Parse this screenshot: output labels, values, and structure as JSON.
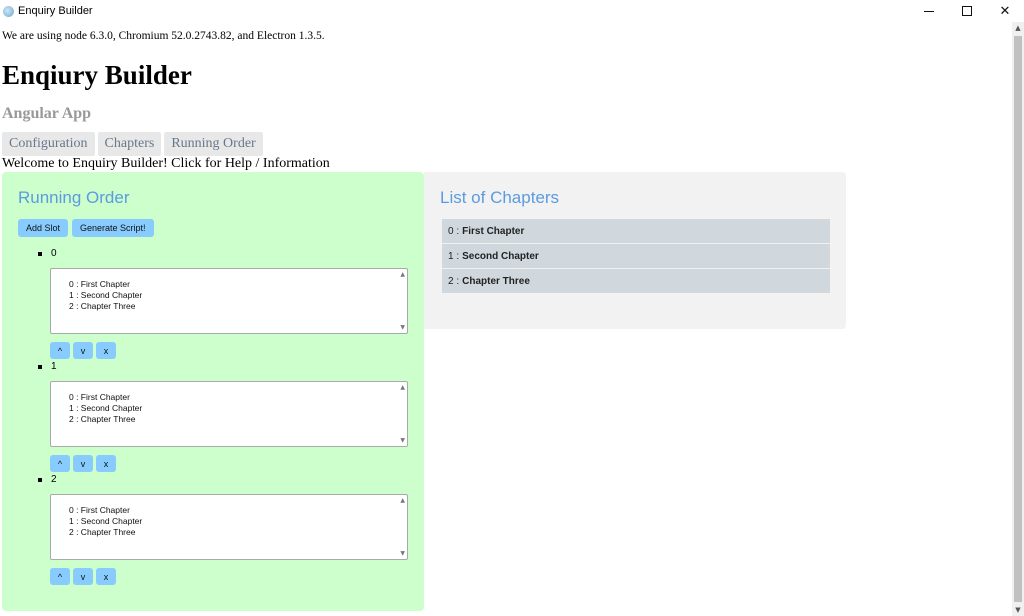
{
  "window": {
    "title": "Enquiry Builder",
    "controls": {
      "minimize": "",
      "maximize": "",
      "close": "✕"
    }
  },
  "page": {
    "version_text": "We are using node 6.3.0, Chromium 52.0.2743.82, and Electron 1.3.5.",
    "heading": "Enqiury Builder",
    "subheading": "Angular App",
    "tabs": [
      {
        "label": "Configuration"
      },
      {
        "label": "Chapters"
      },
      {
        "label": "Running Order"
      }
    ],
    "welcome": "Welcome to Enquiry Builder! Click for Help / Information"
  },
  "running_order": {
    "title": "Running Order",
    "add_slot_label": "Add Slot",
    "generate_label": "Generate Script!",
    "slots": [
      {
        "index": "0",
        "options": [
          "0 : First Chapter",
          "1 : Second Chapter",
          "2 : Chapter Three"
        ],
        "buttons": [
          "^",
          "v",
          "x"
        ]
      },
      {
        "index": "1",
        "options": [
          "0 : First Chapter",
          "1 : Second Chapter",
          "2 : Chapter Three"
        ],
        "buttons": [
          "^",
          "v",
          "x"
        ]
      },
      {
        "index": "2",
        "options": [
          "0 : First Chapter",
          "1 : Second Chapter",
          "2 : Chapter Three"
        ],
        "buttons": [
          "^",
          "v",
          "x"
        ]
      }
    ]
  },
  "chapters": {
    "title": "List of Chapters",
    "items": [
      {
        "index": "0 :",
        "name": "First Chapter"
      },
      {
        "index": "1 :",
        "name": "Second Chapter"
      },
      {
        "index": "2 :",
        "name": "Chapter Three"
      }
    ]
  },
  "icons": {
    "scroll_up": "▲",
    "scroll_down": "▼"
  },
  "colors": {
    "running_order_bg": "#ccffcc",
    "chapters_bg": "#f2f2f2",
    "button_blue": "#88ccff",
    "panel_title": "#5b9be0",
    "chapter_item_bg": "#d0d8dd"
  }
}
